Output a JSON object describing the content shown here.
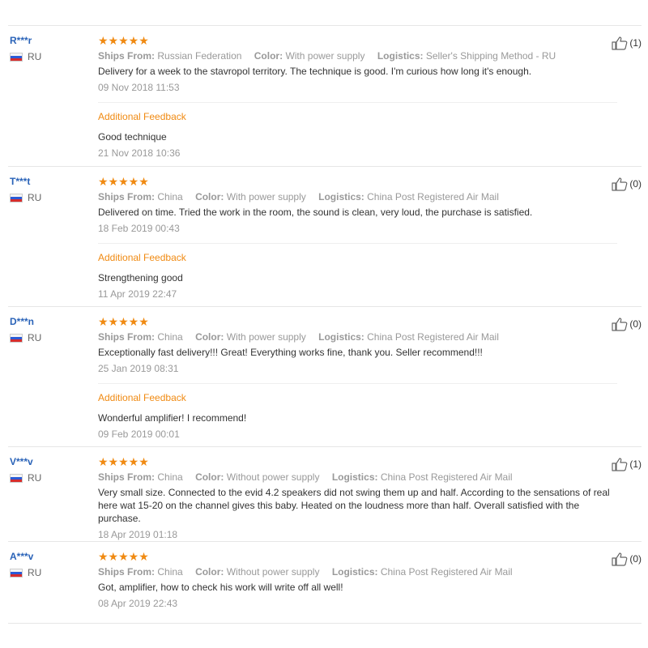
{
  "labels": {
    "ships_from": "Ships From:",
    "color": "Color:",
    "logistics": "Logistics:",
    "additional_feedback": "Additional Feedback"
  },
  "reviews": [
    {
      "user": "R***r",
      "country": "RU",
      "stars": "★★★★★",
      "ships_from": "Russian Federation",
      "color": "With power supply",
      "logistics": "Seller's Shipping Method - RU",
      "text": "Delivery for a week to the stavropol territory. The technique is good. I'm curious how long it's enough.",
      "date": "09 Nov 2018 11:53",
      "helpful": "(1)",
      "additional": {
        "text": "Good technique",
        "date": "21 Nov 2018 10:36"
      }
    },
    {
      "user": "T***t",
      "country": "RU",
      "stars": "★★★★★",
      "ships_from": "China",
      "color": "With power supply",
      "logistics": "China Post Registered Air Mail",
      "text": "Delivered on time. Tried the work in the room, the sound is clean, very loud, the purchase is satisfied.",
      "date": "18 Feb 2019 00:43",
      "helpful": "(0)",
      "additional": {
        "text": "Strengthening good",
        "date": "11 Apr 2019 22:47"
      }
    },
    {
      "user": "D***n",
      "country": "RU",
      "stars": "★★★★★",
      "ships_from": "China",
      "color": "With power supply",
      "logistics": "China Post Registered Air Mail",
      "text": "Exceptionally fast delivery!!! Great! Everything works fine, thank you. Seller recommend!!!",
      "date": "25 Jan 2019 08:31",
      "helpful": "(0)",
      "additional": {
        "text": "Wonderful amplifier! I recommend!",
        "date": "09 Feb 2019 00:01"
      }
    },
    {
      "user": "V***v",
      "country": "RU",
      "stars": "★★★★★",
      "ships_from": "China",
      "color": "Without power supply",
      "logistics": "China Post Registered Air Mail",
      "text": "Very small size. Connected to the evid 4.2 speakers did not swing them up and half. According to the sensations of real here wat 15-20 on the channel gives this baby. Heated on the loudness more than half. Overall satisfied with the purchase.",
      "date": "18 Apr 2019 01:18",
      "helpful": "(1)"
    },
    {
      "user": "A***v",
      "country": "RU",
      "stars": "★★★★★",
      "ships_from": "China",
      "color": "Without power supply",
      "logistics": "China Post Registered Air Mail",
      "text": "Got, amplifier, how to check his work will write off all well!",
      "date": "08 Apr 2019 22:43",
      "helpful": "(0)"
    }
  ]
}
